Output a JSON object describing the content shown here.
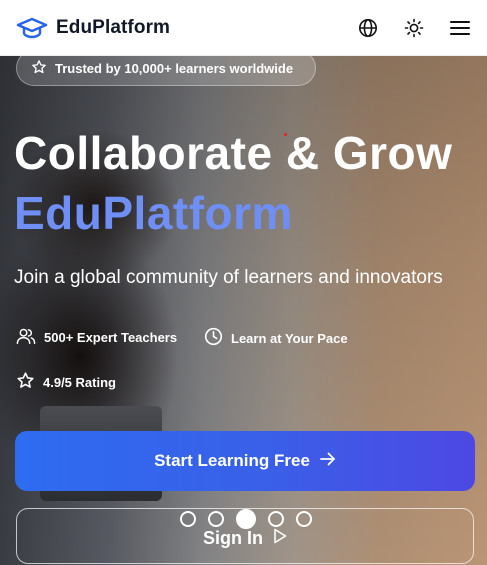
{
  "header": {
    "brand": "EduPlatform",
    "icons": {
      "logo": "graduation-cap-icon",
      "language": "globe-icon",
      "theme": "sun-icon",
      "menu": "hamburger-menu-icon"
    }
  },
  "hero": {
    "trust_badge": "Trusted by 10,000+ learners worldwide",
    "title_line1": "Collaborate & Grow",
    "title_line2": "EduPlatform",
    "subtitle": "Join a global community of learners and innovators",
    "features": [
      {
        "label": "500+ Expert Teachers",
        "icon": "users-icon"
      },
      {
        "label": "Learn at Your Pace",
        "icon": "clock-icon"
      },
      {
        "label": "4.9/5 Rating",
        "icon": "star-icon"
      }
    ],
    "cta_label": "Start Learning Free",
    "signin_label": "Sign In",
    "carousel": {
      "count": 5,
      "active": 3
    }
  },
  "colors": {
    "accent": "#6f8ff5",
    "cta_start": "#2d6cf0",
    "cta_end": "#4d48e3",
    "brand_icon": "#2563eb"
  }
}
